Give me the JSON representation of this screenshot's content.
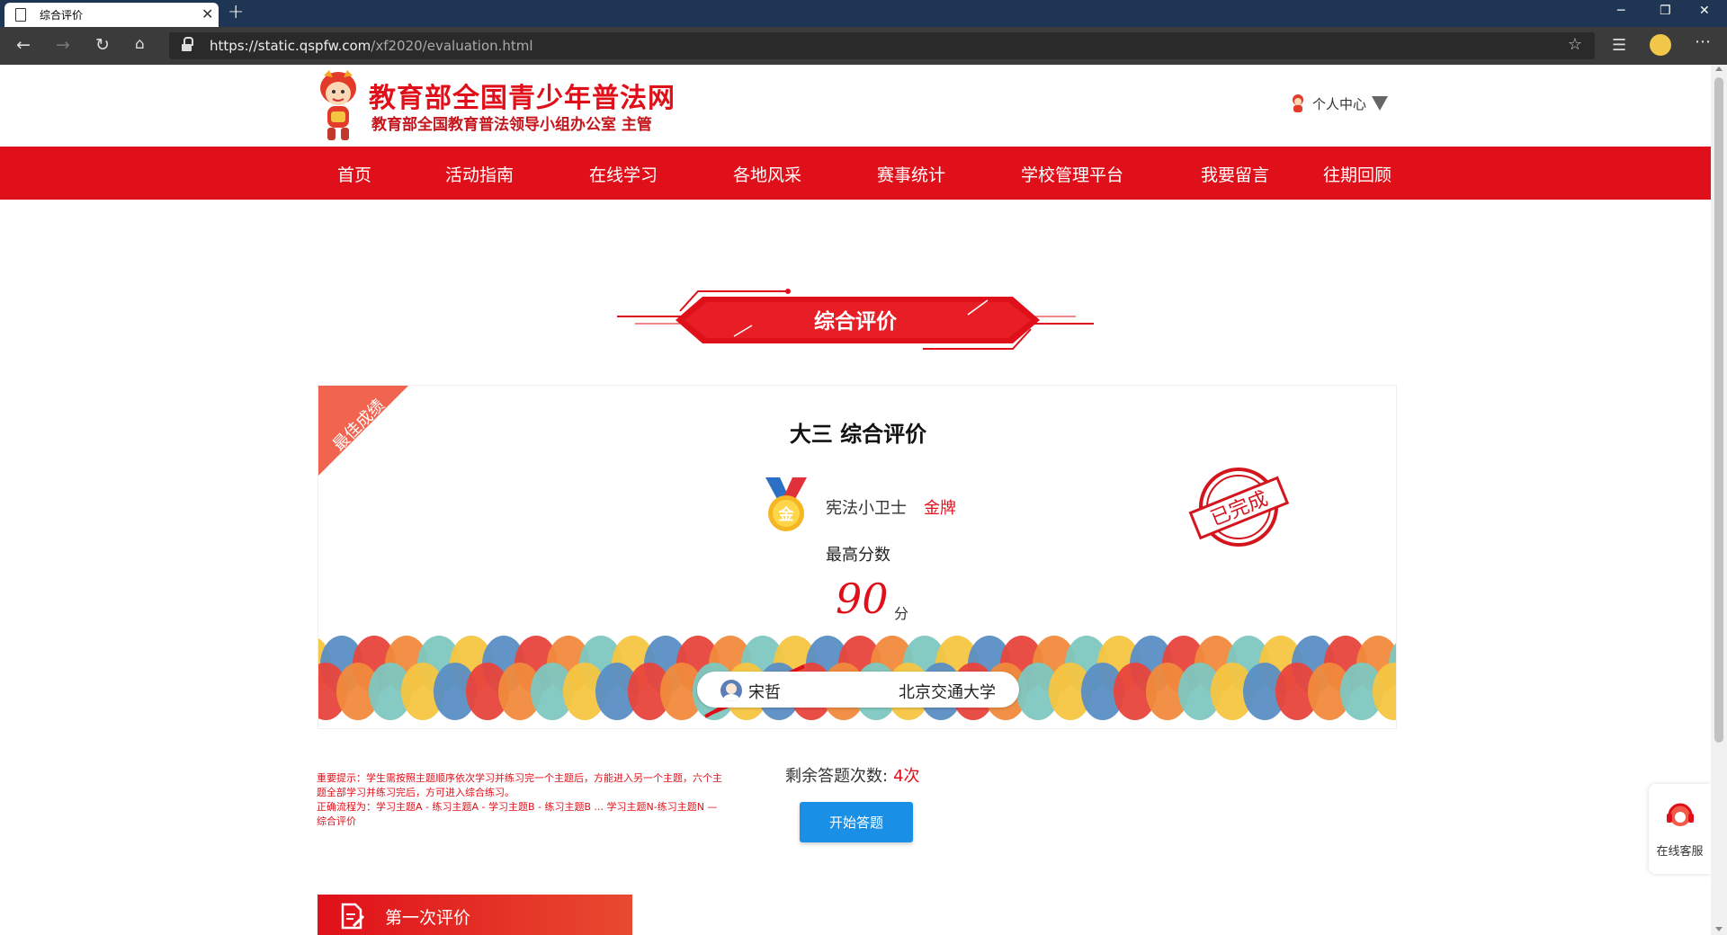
{
  "browser": {
    "tab_title": "综合评价",
    "url_main": "https://static.qspfw.com",
    "url_path": "/xf2020/evaluation.html"
  },
  "site": {
    "title": "教育部全国青少年普法网",
    "subtitle": "教育部全国教育普法领导小组办公室 主管",
    "user_center": "个人中心"
  },
  "nav": {
    "items": [
      "首页",
      "活动指南",
      "在线学习",
      "各地风采",
      "赛事统计",
      "学校管理平台",
      "我要留言",
      "往期回顾"
    ]
  },
  "banner": {
    "title": "综合评价"
  },
  "card": {
    "ribbon": "最佳成绩",
    "title": "大三 综合评价",
    "medal_name": "宪法小卫士",
    "medal_level": "金牌",
    "medal_char": "金",
    "stamp_text": "已完成",
    "best_label": "最高分数",
    "score": "90",
    "score_unit": "分",
    "user_name": "宋哲",
    "school": "北京交通大学"
  },
  "notice": {
    "line1": "重要提示：学生需按照主题顺序依次学习并练习完一个主题后，方能进入另一个主题，六个主题全部学习并练习完后，方可进入综合练习。",
    "line2": "正确流程为：学习主题A - 练习主题A - 学习主题B - 练习主题B ... 学习主题N-练习主题N — 综合评价"
  },
  "remain": {
    "label": "剩余答题次数:",
    "value": "4次"
  },
  "start_button": "开始答题",
  "section": {
    "title": "第一次评价"
  },
  "service": {
    "label": "在线客服"
  },
  "colors": {
    "brand_red": "#e0101a",
    "button_blue": "#1a8fe6"
  }
}
